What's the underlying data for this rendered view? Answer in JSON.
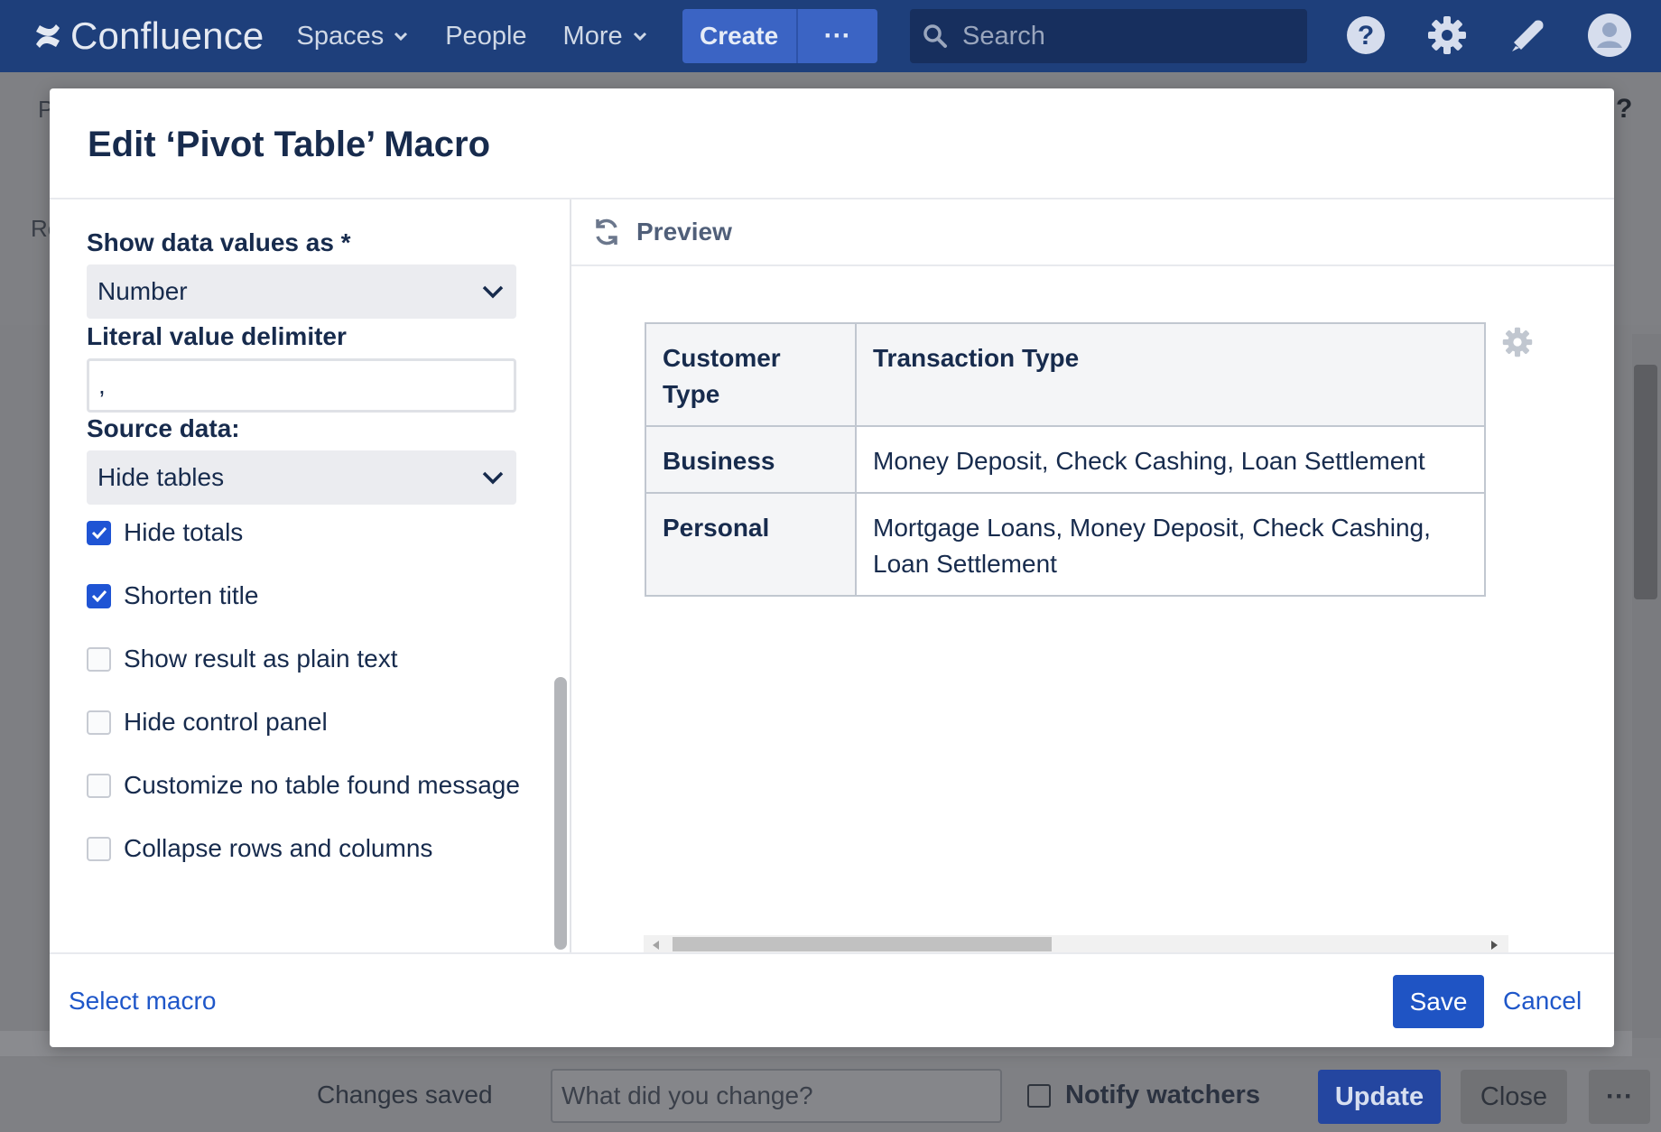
{
  "topbar": {
    "logo_text": "Confluence",
    "nav": [
      {
        "label": "Spaces",
        "has_chevron": true
      },
      {
        "label": "People",
        "has_chevron": false
      },
      {
        "label": "More",
        "has_chevron": true
      }
    ],
    "create_label": "Create",
    "create_more_label": "···",
    "search_placeholder": "Search",
    "icons": [
      "help-icon",
      "settings-gear-icon",
      "notifications-megaphone-icon",
      "user-avatar-icon"
    ]
  },
  "dialog": {
    "title": "Edit ‘Pivot Table’ Macro",
    "form": {
      "show_data_values_label": "Show data values as *",
      "show_data_values_value": "Number",
      "delimiter_label": "Literal value delimiter",
      "delimiter_value": ",",
      "source_data_label": "Source data:",
      "source_data_value": "Hide tables",
      "checkboxes": [
        {
          "label": "Hide totals",
          "checked": true
        },
        {
          "label": "Shorten title",
          "checked": true
        },
        {
          "label": "Show result as plain text",
          "checked": false
        },
        {
          "label": "Hide control panel",
          "checked": false
        },
        {
          "label": "Customize no table found message",
          "checked": false
        },
        {
          "label": "Collapse rows and columns",
          "checked": false
        }
      ]
    },
    "preview": {
      "title": "Preview",
      "table": {
        "headers": [
          "Customer Type",
          "Transaction Type"
        ],
        "rows": [
          [
            "Business",
            "Money Deposit, Check Cashing, Loan Settlement"
          ],
          [
            "Personal",
            "Mortgage Loans, Money Deposit, Check Cashing, Loan Settlement"
          ]
        ]
      }
    },
    "footer": {
      "select_macro": "Select macro",
      "save": "Save",
      "cancel": "Cancel"
    }
  },
  "background": {
    "letters": [
      "P",
      "Re"
    ],
    "help_glyph": "?"
  },
  "bottombar": {
    "status": "Changes saved",
    "change_placeholder": "What did you change?",
    "notify_label": "Notify watchers",
    "update": "Update",
    "close": "Close",
    "more": "···"
  },
  "colors": {
    "topbar": "#1e3f7b",
    "primary": "#1f54c4",
    "link": "#1f57c9",
    "checkbox_on": "#1f54d4"
  }
}
